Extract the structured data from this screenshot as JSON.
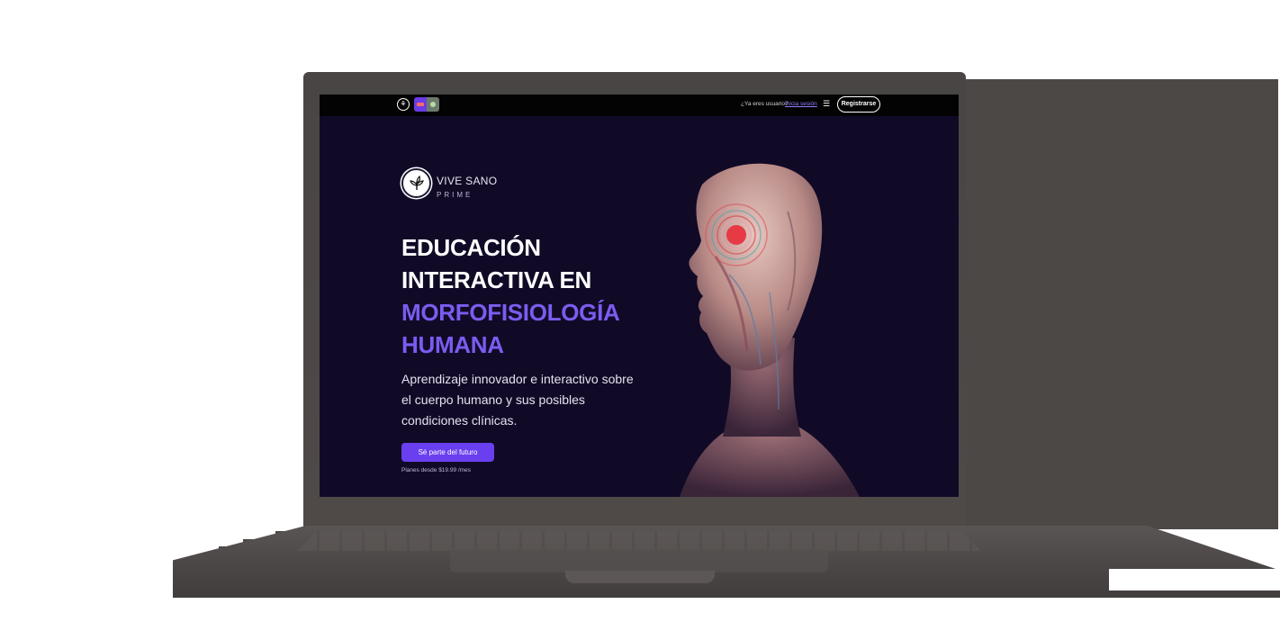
{
  "topbar": {
    "login_question": "¿Ya eres usuario?",
    "login_link": "Inicia sesión",
    "register_label": "Registrarse",
    "menu_icon": "hamburger-icon",
    "logo_icon": "leaf-icon",
    "app_badge_icon": "app-badge-icon"
  },
  "brand": {
    "name": "VIVE SANO",
    "sub": "PRIME",
    "icon": "leaf-icon"
  },
  "hero": {
    "headline_line1": "EDUCACIÓN",
    "headline_line2": "INTERACTIVA EN",
    "headline_line3": "MORFOFISIOLOGÍA",
    "headline_line4": "HUMANA",
    "subtitle": "Aprendizaje innovador e interactivo sobre el cuerpo humano y sus posibles condiciones clínicas.",
    "cta_label": "Sé parte del futuro",
    "price_note": "Planes desde $19.99 /mes"
  },
  "colors": {
    "background": "#110a27",
    "accent": "#7b5cf0",
    "button": "#6a3ff0",
    "topbar": "#030303"
  }
}
